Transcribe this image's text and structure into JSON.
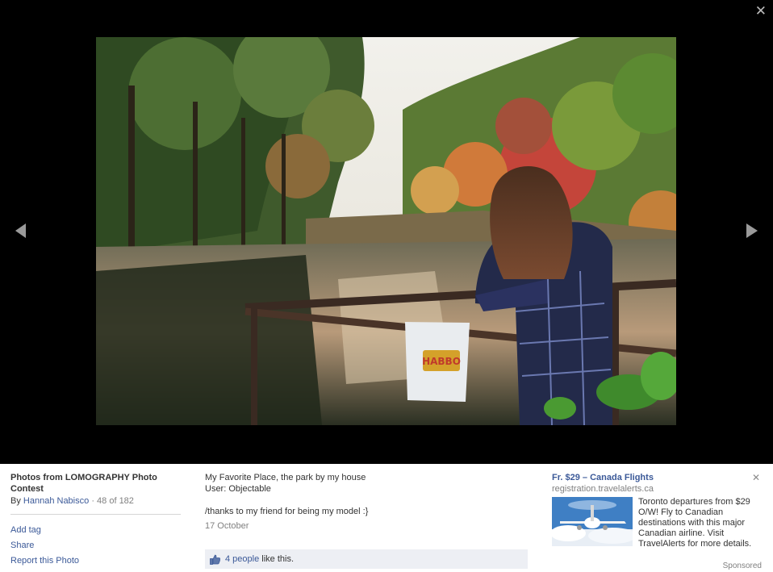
{
  "viewer": {
    "close_glyph": "✕",
    "prev_icon": "left-triangle-arrow",
    "next_icon": "right-triangle-arrow",
    "photo_sign_text": "HABBO"
  },
  "album": {
    "title": "Photos from LOMOGRAPHY Photo Contest",
    "by_prefix": "By",
    "author": "Hannah Nabisco",
    "separator": "·",
    "position": "48 of 182"
  },
  "actions": [
    "Add tag",
    "Share",
    "Report this Photo"
  ],
  "caption": {
    "text": "My Favorite Place, the park by my house\nUser: Objectable\n\n/thanks to my friend for being my model :}",
    "date": "17 October"
  },
  "likes": {
    "icon": "thumbs-up-icon",
    "count_link": "4 people",
    "suffix": "like this."
  },
  "ad": {
    "title": "Fr. $29 – Canada Flights",
    "domain": "registration.travelalerts.ca",
    "close_glyph": "✕",
    "body": "Toronto departures from $29 O/W! Fly to Canadian destinations with this major Canadian airline. Visit TravelAlerts for more details.",
    "sponsored": "Sponsored"
  },
  "colors": {
    "link": "#3b5998",
    "stage": "#000000",
    "likes_bar": "#edeff4"
  }
}
